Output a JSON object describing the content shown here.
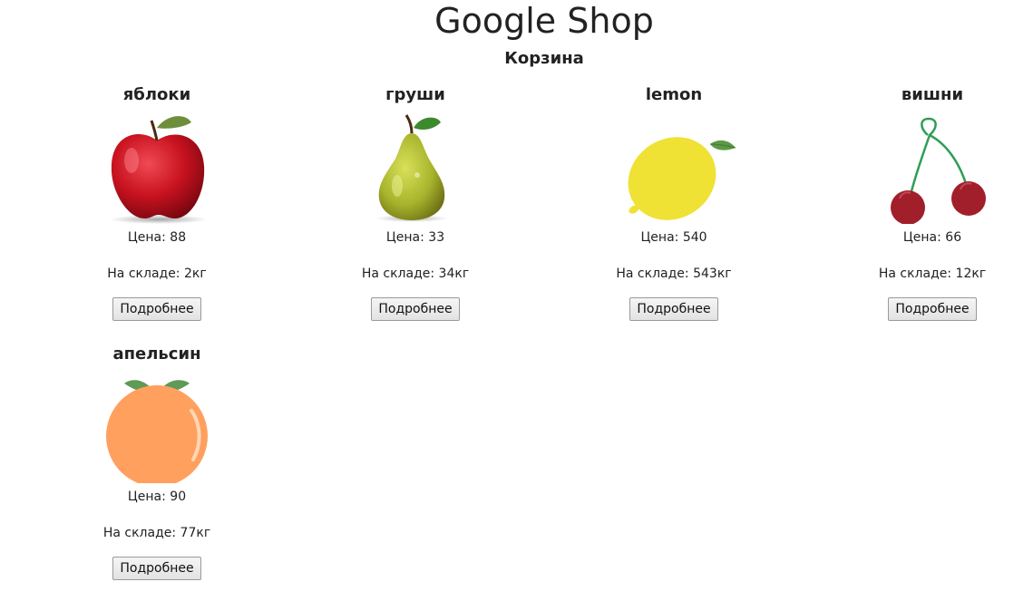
{
  "header": {
    "title": "Google Shop",
    "cart_link": "Корзина"
  },
  "labels": {
    "price_prefix": "Цена: ",
    "stock_prefix": "На складе: ",
    "stock_suffix": "кг",
    "details_button": "Подробнее"
  },
  "products": [
    {
      "name": "яблоки",
      "price": 88,
      "stock": 2,
      "icon": "apple-icon",
      "color": "#c0101e"
    },
    {
      "name": "груши",
      "price": 33,
      "stock": 34,
      "icon": "pear-icon",
      "color": "#a7b42c"
    },
    {
      "name": "lemon",
      "price": 540,
      "stock": 543,
      "icon": "lemon-icon",
      "color": "#f0e135"
    },
    {
      "name": "вишни",
      "price": 66,
      "stock": 12,
      "icon": "cherry-icon",
      "color": "#a11f2a"
    },
    {
      "name": "апельсин",
      "price": 90,
      "stock": 77,
      "icon": "orange-icon",
      "color": "#ffa05f"
    }
  ]
}
